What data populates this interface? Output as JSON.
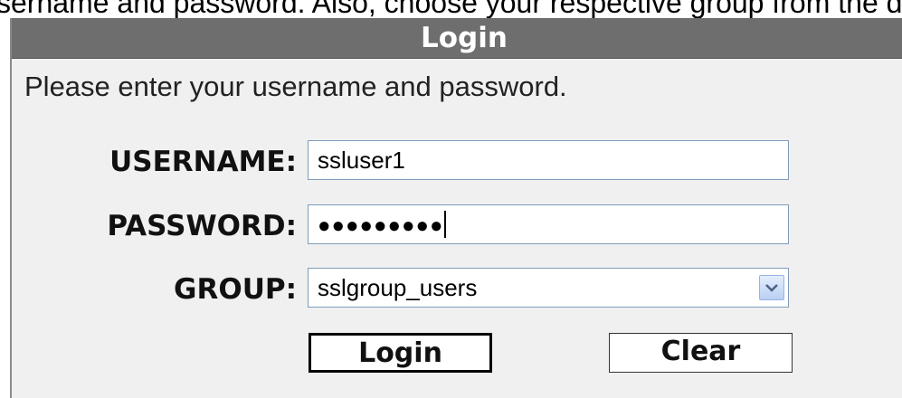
{
  "instruction_text": "sername and password. Also, choose your respective group from the d",
  "login_panel": {
    "title": "Login",
    "prompt": "Please enter your username and password.",
    "username": {
      "label": "USERNAME:",
      "value": "ssluser1"
    },
    "password": {
      "label": "PASSWORD:",
      "mask": "●●●●●●●●●"
    },
    "group": {
      "label": "GROUP:",
      "selected": "sslgroup_users",
      "arrow_icon": "chevron-down-icon"
    },
    "buttons": {
      "login": "Login",
      "clear": "Clear"
    }
  }
}
